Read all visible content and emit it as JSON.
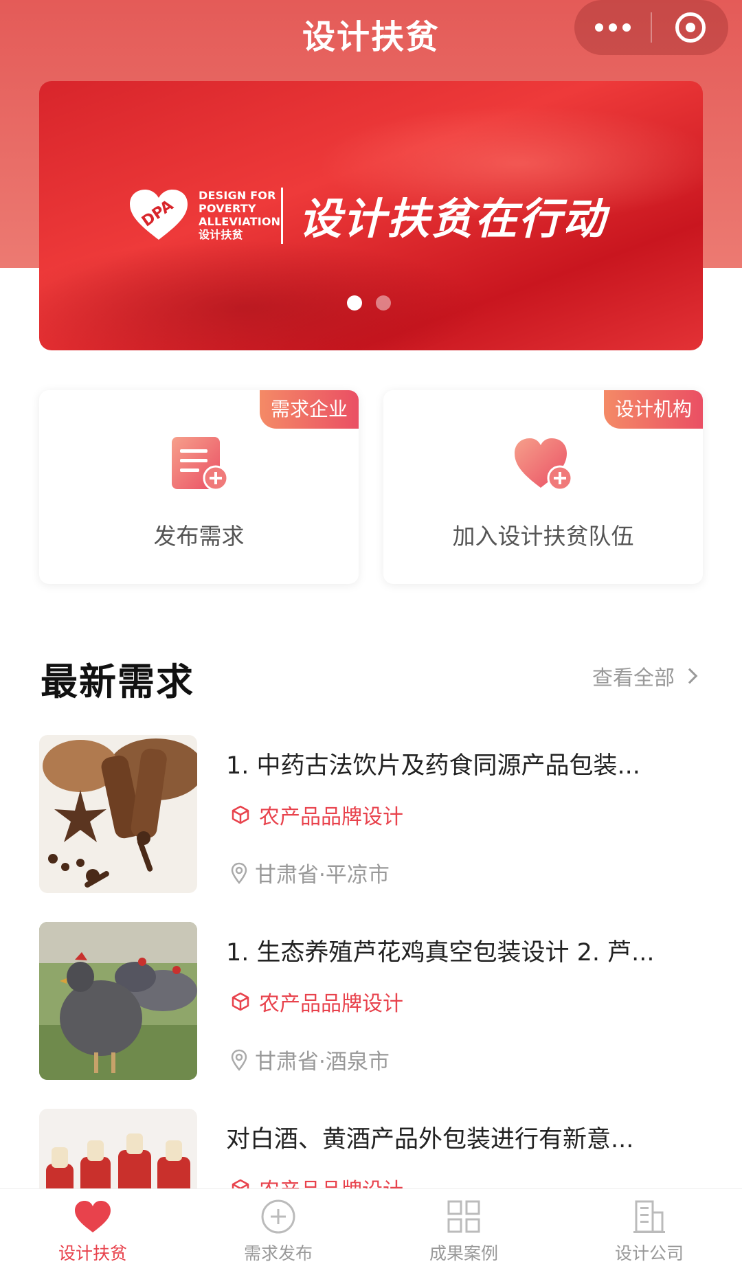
{
  "nav": {
    "title": "设计扶贫"
  },
  "banner": {
    "logo_text": [
      "DESIGN FOR",
      "POVERTY",
      "ALLEVIATION",
      "设计扶贫"
    ],
    "logo_mark": "DPA",
    "slogan": "设计扶贫在行动",
    "slides": 2,
    "active_slide": 1
  },
  "cards": [
    {
      "tag": "需求企业",
      "label": "发布需求",
      "icon": "add-document-icon"
    },
    {
      "tag": "设计机构",
      "label": "加入设计扶贫队伍",
      "icon": "add-heart-icon"
    }
  ],
  "section": {
    "title": "最新需求",
    "view_all": "查看全部"
  },
  "items": [
    {
      "title": "1. 中药古法饮片及药食同源产品包装...",
      "tag": "农产品品牌设计",
      "location": "甘肃省·平凉市",
      "image": "spices"
    },
    {
      "title": "1. 生态养殖芦花鸡真空包装设计 2. 芦...",
      "tag": "农产品品牌设计",
      "location": "甘肃省·酒泉市",
      "image": "chicken"
    },
    {
      "title": "对白酒、黄酒产品外包装进行有新意...",
      "tag": "农产品品牌设计",
      "location": "",
      "image": "wine"
    }
  ],
  "tabs": [
    {
      "label": "设计扶贫",
      "icon": "heart-icon",
      "active": true
    },
    {
      "label": "需求发布",
      "icon": "plus-circle-icon",
      "active": false
    },
    {
      "label": "成果案例",
      "icon": "grid-icon",
      "active": false
    },
    {
      "label": "设计公司",
      "icon": "building-icon",
      "active": false
    }
  ],
  "colors": {
    "brand": "#e8424c",
    "header": "#e45b58",
    "tag_start": "#f48a66",
    "tag_end": "#ea4f64"
  }
}
